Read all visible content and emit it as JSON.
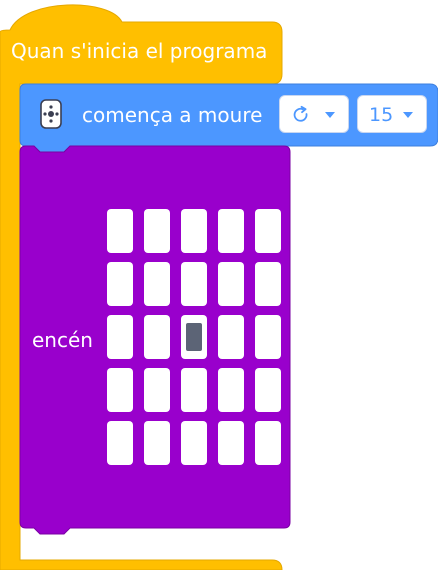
{
  "hat_block": {
    "label": "Quan s'inicia el programa",
    "color": "#ffbf00",
    "border_color": "#e6a800"
  },
  "motion_block": {
    "icon": "remote-control-icon",
    "label": "comença a moure",
    "direction_icon": "rotate-clockwise-icon",
    "speed_value": "15",
    "color": "#4c97ff",
    "border_color": "#3d7fdd"
  },
  "light_block": {
    "label": "encén",
    "color": "#9900cc",
    "border_color": "#7a00a3",
    "led_matrix": [
      [
        0,
        0,
        0,
        0,
        0
      ],
      [
        0,
        0,
        0,
        0,
        0
      ],
      [
        0,
        0,
        1,
        0,
        0
      ],
      [
        0,
        0,
        0,
        0,
        0
      ],
      [
        0,
        0,
        0,
        0,
        0
      ]
    ],
    "led_off_color": "#ffffff",
    "led_on_color": "#5c6476"
  }
}
